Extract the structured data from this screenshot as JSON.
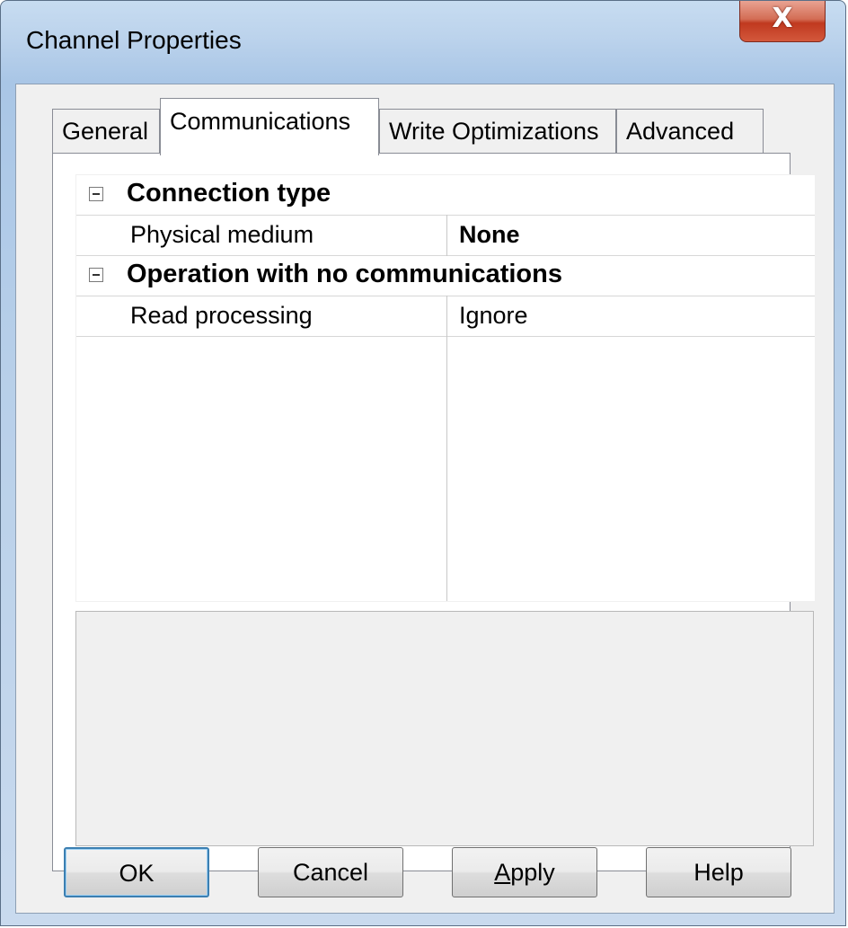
{
  "window": {
    "title": "Channel Properties",
    "close_glyph": "X"
  },
  "tabs": [
    {
      "label": "General",
      "active": false
    },
    {
      "label": "Communications",
      "active": true
    },
    {
      "label": "Write Optimizations",
      "active": false
    },
    {
      "label": "Advanced",
      "active": false
    }
  ],
  "properties": {
    "category_1": {
      "label": "Connection type",
      "icon": "collapse-minus-icon"
    },
    "physical_medium": {
      "name": "Physical medium",
      "value": "None"
    },
    "category_2": {
      "label": "Operation with no communications",
      "icon": "collapse-minus-icon"
    },
    "read_processing": {
      "name": "Read processing",
      "value": "Ignore"
    }
  },
  "buttons": {
    "ok": "OK",
    "cancel": "Cancel",
    "apply_mnemonic": "A",
    "apply_rest": "pply",
    "help": "Help"
  },
  "colors": {
    "titlebar": "#bcd3ec",
    "close_button": "#c0391f",
    "dialog_background": "#f0f0f0"
  }
}
